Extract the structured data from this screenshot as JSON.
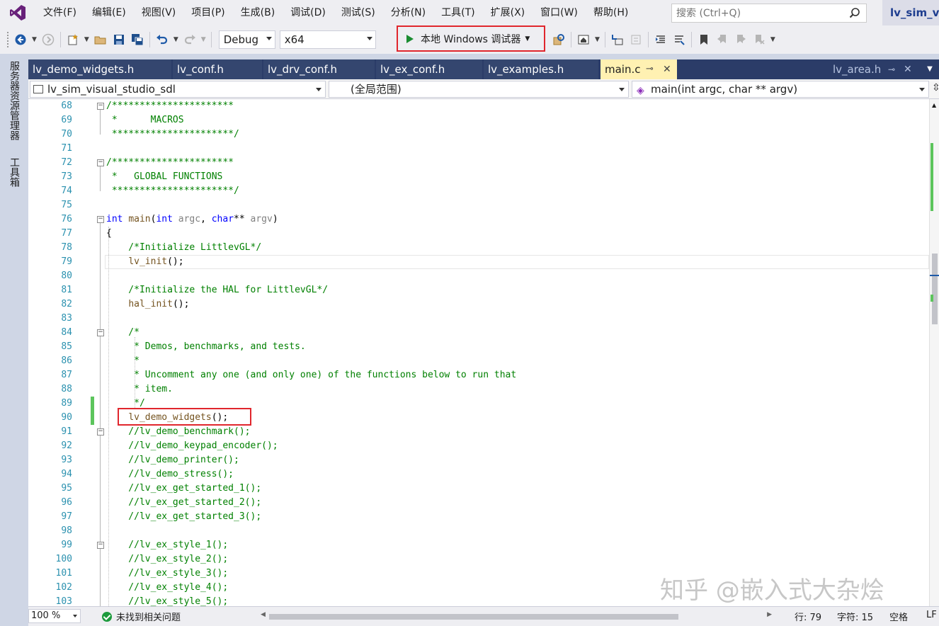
{
  "menu": [
    "文件(F)",
    "编辑(E)",
    "视图(V)",
    "项目(P)",
    "生成(B)",
    "调试(D)",
    "测试(S)",
    "分析(N)",
    "工具(T)",
    "扩展(X)",
    "窗口(W)",
    "帮助(H)"
  ],
  "search": {
    "placeholder": "搜索 (Ctrl+Q)"
  },
  "solution_title": "lv_sim_vis",
  "toolbar": {
    "config": "Debug",
    "platform": "x64",
    "run_label": "本地 Windows 调试器"
  },
  "side_tabs": [
    "服务器资源管理器",
    "工具箱"
  ],
  "tabs": [
    {
      "label": "lv_demo_widgets.h",
      "active": false
    },
    {
      "label": "lv_conf.h",
      "active": false
    },
    {
      "label": "lv_drv_conf.h",
      "active": false
    },
    {
      "label": "lv_ex_conf.h",
      "active": false
    },
    {
      "label": "lv_examples.h",
      "active": false
    },
    {
      "label": "main.c",
      "active": true
    },
    {
      "label": "lv_area.h",
      "active": false
    }
  ],
  "navigation": {
    "project": "lv_sim_visual_studio_sdl",
    "scope": "(全局范围)",
    "member": "main(int argc, char ** argv)"
  },
  "code_lines": [
    {
      "n": "68",
      "text": "/**********************"
    },
    {
      "n": "69",
      "text": " *      MACROS"
    },
    {
      "n": "70",
      "text": " **********************/"
    },
    {
      "n": "71",
      "text": ""
    },
    {
      "n": "72",
      "text": "/**********************"
    },
    {
      "n": "73",
      "text": " *   GLOBAL FUNCTIONS"
    },
    {
      "n": "74",
      "text": " **********************/"
    },
    {
      "n": "75",
      "text": ""
    },
    {
      "n": "76",
      "text": "int main(int argc, char** argv)"
    },
    {
      "n": "77",
      "text": "{"
    },
    {
      "n": "78",
      "text": "    /*Initialize LittlevGL*/"
    },
    {
      "n": "79",
      "text": "    lv_init();"
    },
    {
      "n": "80",
      "text": ""
    },
    {
      "n": "81",
      "text": "    /*Initialize the HAL for LittlevGL*/"
    },
    {
      "n": "82",
      "text": "    hal_init();"
    },
    {
      "n": "83",
      "text": ""
    },
    {
      "n": "84",
      "text": "    /*"
    },
    {
      "n": "85",
      "text": "     * Demos, benchmarks, and tests."
    },
    {
      "n": "86",
      "text": "     *"
    },
    {
      "n": "87",
      "text": "     * Uncomment any one (and only one) of the functions below to run that"
    },
    {
      "n": "88",
      "text": "     * item."
    },
    {
      "n": "89",
      "text": "     */"
    },
    {
      "n": "90",
      "text": "    lv_demo_widgets();"
    },
    {
      "n": "91",
      "text": "    //lv_demo_benchmark();"
    },
    {
      "n": "92",
      "text": "    //lv_demo_keypad_encoder();"
    },
    {
      "n": "93",
      "text": "    //lv_demo_printer();"
    },
    {
      "n": "94",
      "text": "    //lv_demo_stress();"
    },
    {
      "n": "95",
      "text": "    //lv_ex_get_started_1();"
    },
    {
      "n": "96",
      "text": "    //lv_ex_get_started_2();"
    },
    {
      "n": "97",
      "text": "    //lv_ex_get_started_3();"
    },
    {
      "n": "98",
      "text": ""
    },
    {
      "n": "99",
      "text": "    //lv_ex_style_1();"
    },
    {
      "n": "100",
      "text": "    //lv_ex_style_2();"
    },
    {
      "n": "101",
      "text": "    //lv_ex_style_3();"
    },
    {
      "n": "102",
      "text": "    //lv_ex_style_4();"
    },
    {
      "n": "103",
      "text": "    //lv_ex_style_5();"
    }
  ],
  "watermark": "知乎 @嵌入式大杂烩",
  "status": {
    "zoom": "100 %",
    "issues": "未找到相关问题",
    "line": "行: 79",
    "col": "字符: 15",
    "whitespace": "空格",
    "eol": "LF"
  }
}
